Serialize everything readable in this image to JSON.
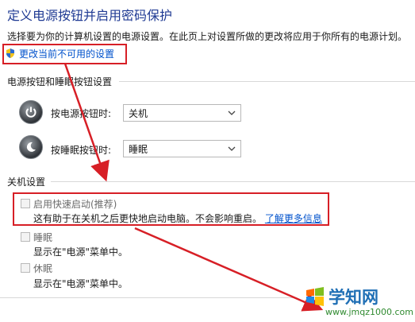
{
  "header": {
    "title": "定义电源按钮并启用密码保护",
    "description": "选择要为你的计算机设置的电源设置。在此页上对设置所做的更改将应用于你所有的电源计划。",
    "change_link": "更改当前不可用的设置"
  },
  "power_buttons": {
    "section_title": "电源按钮和睡眠按钮设置",
    "power_label": "按电源按钮时:",
    "power_value": "关机",
    "sleep_label": "按睡眠按钮时:",
    "sleep_value": "睡眠"
  },
  "shutdown": {
    "section_title": "关机设置",
    "fast_startup_label": "启用快速启动(推荐)",
    "fast_startup_desc": "这有助于在关机之后更快地启动电脑。不会影响重启。",
    "learn_more": "了解更多信息",
    "sleep_label": "睡眠",
    "sleep_desc": "显示在\"电源\"菜单中。",
    "hibernate_label": "休眠",
    "hibernate_desc": "显示在\"电源\"菜单中。"
  },
  "watermark": {
    "text": "学知网",
    "url": "www.jmqz1000.com"
  },
  "colors": {
    "annotation_red": "#d71f26",
    "link_blue": "#0052cc",
    "title_blue": "#1f3a93"
  }
}
